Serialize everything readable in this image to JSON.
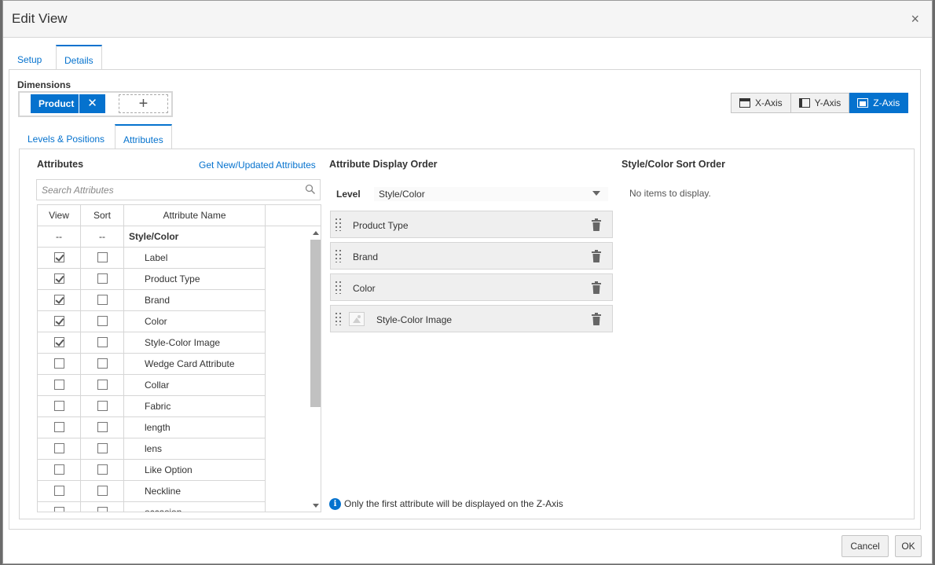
{
  "dialog": {
    "title": "Edit View",
    "close_glyph": "×"
  },
  "tabs": [
    "Setup",
    "Details"
  ],
  "active_tab": "Details",
  "dimensions": {
    "label": "Dimensions",
    "chip_label": "Product",
    "remove_glyph": "✕",
    "add_glyph": "+"
  },
  "axis_buttons": [
    {
      "label": "X-Axis",
      "icon": "x-axis-icon",
      "active": false
    },
    {
      "label": "Y-Axis",
      "icon": "y-axis-icon",
      "active": false
    },
    {
      "label": "Z-Axis",
      "icon": "z-axis-icon",
      "active": true
    }
  ],
  "sub_tabs": [
    "Levels & Positions",
    "Attributes"
  ],
  "active_sub_tab": "Attributes",
  "attributes": {
    "title": "Attributes",
    "link": "Get New/Updated Attributes",
    "search_placeholder": "Search Attributes",
    "columns": [
      "View",
      "Sort",
      "Attribute Name"
    ],
    "group_row": {
      "view": "--",
      "sort": "--",
      "name": "Style/Color"
    },
    "rows": [
      {
        "name": "Label",
        "view": true,
        "sort": false
      },
      {
        "name": "Product Type",
        "view": true,
        "sort": false
      },
      {
        "name": "Brand",
        "view": true,
        "sort": false
      },
      {
        "name": "Color",
        "view": true,
        "sort": false
      },
      {
        "name": "Style-Color Image",
        "view": true,
        "sort": false
      },
      {
        "name": "Wedge Card Attribute",
        "view": false,
        "sort": false
      },
      {
        "name": "Collar",
        "view": false,
        "sort": false
      },
      {
        "name": "Fabric",
        "view": false,
        "sort": false
      },
      {
        "name": "length",
        "view": false,
        "sort": false
      },
      {
        "name": "lens",
        "view": false,
        "sort": false
      },
      {
        "name": "Like Option",
        "view": false,
        "sort": false
      },
      {
        "name": "Neckline",
        "view": false,
        "sort": false
      },
      {
        "name": "occasion",
        "view": false,
        "sort": false
      }
    ]
  },
  "display_order": {
    "title": "Attribute Display Order",
    "level_label": "Level",
    "level_value": "Style/Color",
    "items": [
      {
        "label": "Product Type",
        "image": false
      },
      {
        "label": "Brand",
        "image": false
      },
      {
        "label": "Color",
        "image": false
      },
      {
        "label": "Style-Color Image",
        "image": true
      }
    ],
    "note": "Only the first attribute will be displayed on the Z-Axis",
    "note_icon_glyph": "i"
  },
  "sort_order": {
    "title": "Style/Color Sort Order",
    "empty_text": "No items to display."
  },
  "footer": {
    "cancel_label": "Cancel",
    "ok_label": "OK"
  },
  "colors": {
    "accent": "#0572ce",
    "border": "#d6d6d6",
    "header_bg": "#f5f5f5"
  }
}
